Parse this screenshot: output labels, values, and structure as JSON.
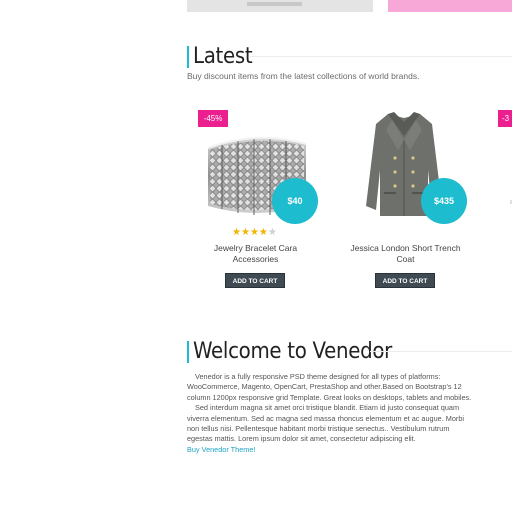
{
  "latest": {
    "title": "Latest",
    "subtitle": "Buy discount items from the latest collections of world brands."
  },
  "products": [
    {
      "name": "Jewelry Bracelet Cara Accessories",
      "price": "$40",
      "badge": "-45%",
      "rating": 4,
      "cart_label": "ADD TO CART"
    },
    {
      "name": "Jessica London Short Trench Coat",
      "price": "$435",
      "badge": "",
      "cart_label": "ADD TO CART"
    },
    {
      "name": "",
      "price": "",
      "badge": "-3",
      "cart_label": ""
    }
  ],
  "welcome": {
    "title": "Welcome to Venedor",
    "para1": "Venedor is a fully responsive PSD theme designed for all types of platforms: WooCommerce, Magento, OpenCart, PrestaShop and other.Based on Bootstrap's 12 column 1200px responsive grid Template. Great looks on desktops, tablets and mobiles.",
    "para2": "Sed interdum magna sit amet orci tristique blandit. Etiam id justo consequat quam viverra elementum. Sed ac magna sed massa rhoncus elementum et ac augue. Morbi non tellus nisi. Pellentesque habitant morbi tristique senectus.. Vestibulum rutrum egestas mattis. Lorem ipsum dolor sit amet, consectetur adipiscing elit.",
    "link": "Buy Venedor Theme!"
  },
  "colors": {
    "accent": "#1ebccf",
    "sale": "#ec1f8e",
    "star": "#f3b400",
    "button": "#3f4a52"
  },
  "icons": {
    "star": "star-icon"
  }
}
